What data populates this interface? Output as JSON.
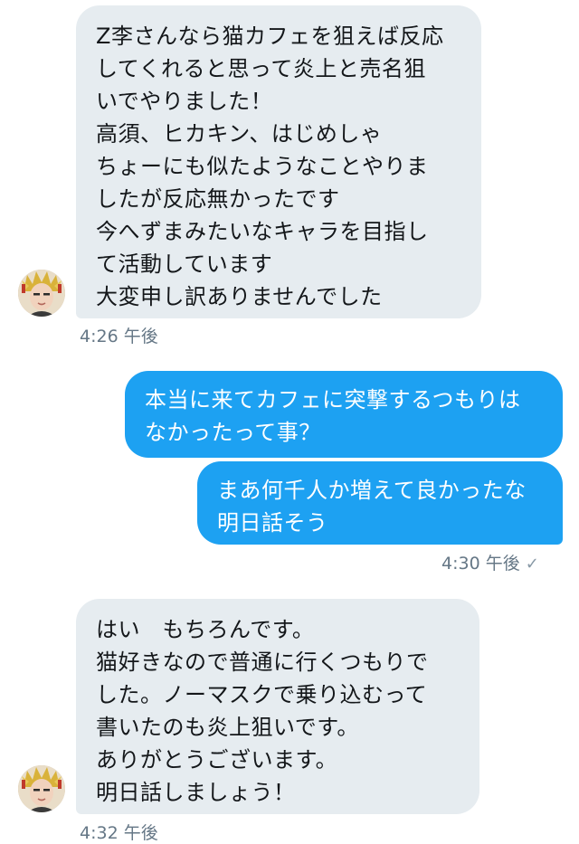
{
  "conversation": {
    "messages": [
      {
        "sender": "other",
        "lines": [
          "Z李さんなら猫カフェを狙えば反応",
          "してくれると思って炎上と売名狙",
          "いでやりました！",
          "高須、ヒカキン、はじめしゃ",
          "ちょーにも似たようなことやりま",
          "したが反応無かったです",
          "今へずまみたいなキャラを目指し",
          "て活動しています",
          "大変申し訳ありませんでした"
        ],
        "time": "4:26 午後"
      },
      {
        "sender": "me",
        "lines": [
          "本当に来てカフェに突撃するつもりは",
          "なかったって事？"
        ]
      },
      {
        "sender": "me",
        "lines": [
          "まあ何千人か増えて良かったな",
          "明日話そう"
        ],
        "time": "4:30 午後",
        "read_mark": "✓"
      },
      {
        "sender": "other",
        "lines": [
          "はい　もちろんです。",
          "猫好きなので普通に行くつもりで",
          "した。ノーマスクで乗り込むって",
          "書いたのも炎上狙いです。",
          "ありがとうございます。",
          "明日話しましょう！"
        ],
        "time": "4:32 午後"
      }
    ]
  },
  "icons": {
    "avatar": "user-avatar-icon",
    "read_receipt": "checkmark-icon"
  },
  "colors": {
    "incoming_bubble": "#e6ecf0",
    "outgoing_bubble": "#1da1f2",
    "timestamp": "#657786"
  }
}
